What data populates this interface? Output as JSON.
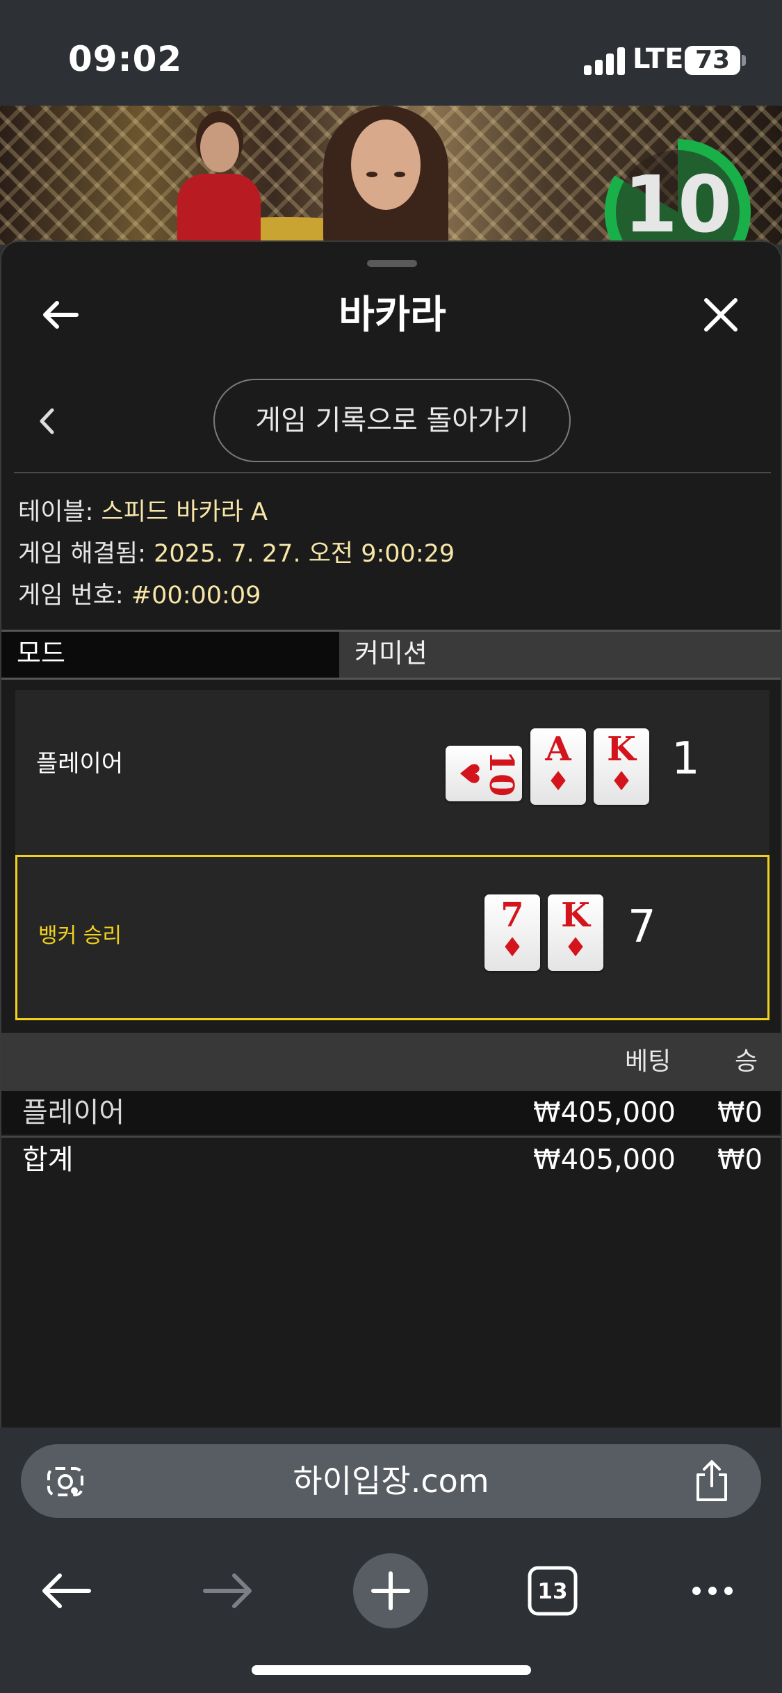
{
  "status_bar": {
    "time": "09:02",
    "network": "LTE",
    "battery": "73"
  },
  "video": {
    "countdown": "10"
  },
  "header": {
    "title": "바카라"
  },
  "history_button": {
    "label": "게임 기록으로 돌아가기"
  },
  "info": {
    "table_label": "테이블:",
    "table_value": "스피드 바카라 A",
    "resolved_label": "게임 해결됨:",
    "resolved_value": "2025. 7. 27. 오전 9:00:29",
    "game_no_label": "게임 번호:",
    "game_no_value": "#00:00:09"
  },
  "mode": {
    "label": "모드",
    "value": "커미션"
  },
  "hands": {
    "player": {
      "label": "플레이어",
      "score": "1",
      "cards": [
        {
          "rank": "10",
          "suit": "♥",
          "sideways": true
        },
        {
          "rank": "A",
          "suit": "♦"
        },
        {
          "rank": "K",
          "suit": "♦"
        }
      ]
    },
    "banker": {
      "label": "뱅커 승리",
      "score": "7",
      "cards": [
        {
          "rank": "7",
          "suit": "♦"
        },
        {
          "rank": "K",
          "suit": "♦"
        }
      ]
    }
  },
  "bets_table": {
    "headers": {
      "bet": "베팅",
      "win": "승"
    },
    "rows": [
      {
        "name": "플레이어",
        "bet": "₩405,000",
        "win": "₩0"
      }
    ],
    "total": {
      "name": "합계",
      "bet": "₩405,000",
      "win": "₩0"
    }
  },
  "browser": {
    "url": "하이입장.com",
    "tab_count": "13"
  },
  "colors": {
    "winner_highlight": "#f2d11c",
    "info_value": "#f7e6a8",
    "card_red": "#d4141c",
    "timer_green": "#19b04a"
  }
}
